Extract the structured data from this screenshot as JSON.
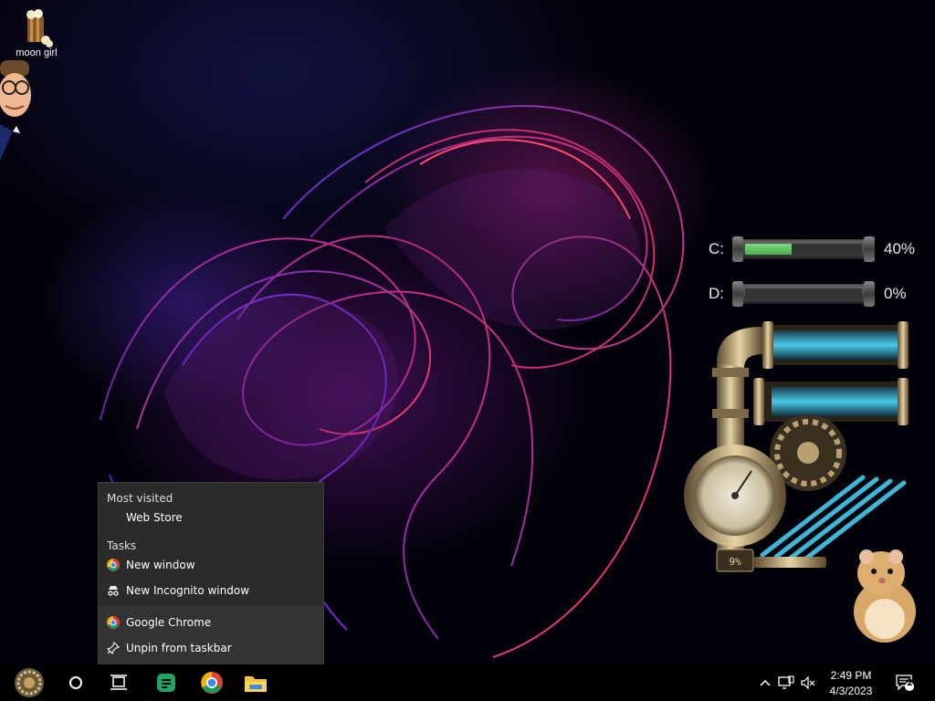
{
  "desktop": {
    "icons": [
      {
        "name": "moon girl",
        "label": "moon girl"
      }
    ]
  },
  "drives": [
    {
      "letter": "C:",
      "percent_text": "40%",
      "usage": 0.4
    },
    {
      "letter": "D:",
      "percent_text": "0%",
      "usage": 0.0
    }
  ],
  "gadget": {
    "cpu_readout": "9%"
  },
  "jumplist": {
    "sections": {
      "most_visited": "Most visited",
      "tasks": "Tasks"
    },
    "most_visited_items": [
      "Web Store"
    ],
    "task_items": [
      "New window",
      "New Incognito window"
    ],
    "app_items": [
      "Google Chrome",
      "Unpin from taskbar"
    ]
  },
  "taskbar": {
    "clock_time": "2:49 PM",
    "clock_date": "4/3/2023",
    "notification_count": "2",
    "pinned": [
      "start-icon",
      "cortana-icon",
      "task-view-icon",
      "sheets-icon",
      "chrome-icon",
      "file-explorer-icon"
    ]
  },
  "colors": {
    "taskbar_bg": "#000000",
    "jumplist_bg": "#2b2b2b",
    "drive_fill": "#4caf50",
    "pipe_glass": "#3fb6d8"
  }
}
